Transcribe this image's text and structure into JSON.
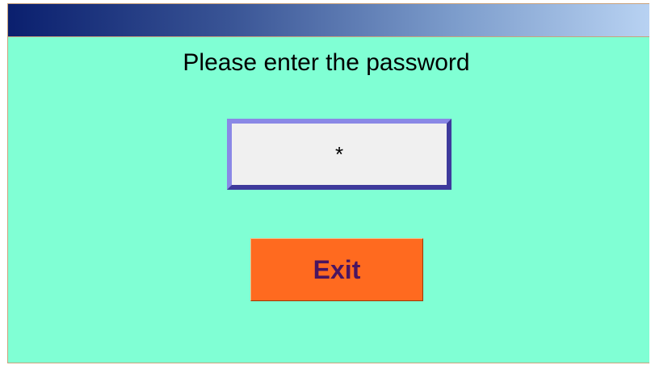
{
  "dialog": {
    "prompt": "Please enter the password",
    "password_mask": "*",
    "exit_label": "Exit"
  },
  "colors": {
    "background": "#80ffd4",
    "titlebar_start": "#0a1f6e",
    "titlebar_end": "#b8d2f2",
    "exit_button": "#ff6a1f",
    "exit_text": "#4a1560",
    "field_border": "#5c58c8"
  }
}
